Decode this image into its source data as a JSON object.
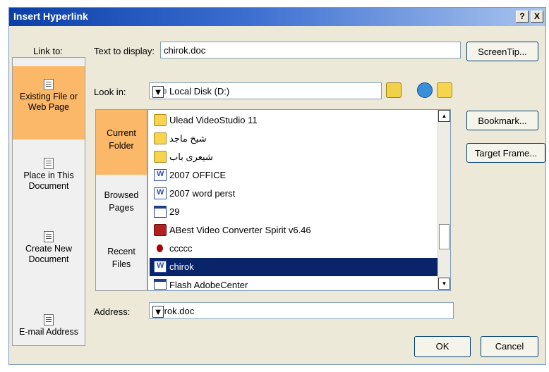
{
  "window": {
    "title": "Insert Hyperlink",
    "help_button": "?",
    "close_button": "X"
  },
  "link_to": {
    "label": "Link to:",
    "items": [
      {
        "line1": "Existing File or",
        "line2": "Web Page",
        "icon": "file-web-icon"
      },
      {
        "line1": "Place in This",
        "line2": "Document",
        "icon": "document-place-icon"
      },
      {
        "line1": "Create New",
        "line2": "Document",
        "icon": "new-document-icon"
      },
      {
        "line1": "E-mail Address",
        "line2": "",
        "icon": "email-icon"
      }
    ]
  },
  "text_to_display": {
    "label": "Text to display:",
    "value": "chirok.doc"
  },
  "buttons": {
    "screentip": "ScreenTip...",
    "bookmark": "Bookmark...",
    "target_frame": "Target Frame...",
    "ok": "OK",
    "cancel": "Cancel"
  },
  "look_in": {
    "label": "Look in:",
    "value": "Local Disk  (D:)"
  },
  "sub_nav": [
    {
      "line1": "Current",
      "line2": "Folder"
    },
    {
      "line1": "Browsed",
      "line2": "Pages"
    },
    {
      "line1": "Recent",
      "line2": "Files"
    }
  ],
  "files": [
    {
      "name": "Ulead VideoStudio 11",
      "icon": "folder-icon"
    },
    {
      "name": "شيخ ماجد",
      "icon": "folder-icon"
    },
    {
      "name": "شيعرى باب",
      "icon": "folder-icon"
    },
    {
      "name": "2007 OFFICE",
      "icon": "word-doc-icon"
    },
    {
      "name": "2007 word perst",
      "icon": "word-doc-icon"
    },
    {
      "name": "29",
      "icon": "app-window-icon"
    },
    {
      "name": "ABest Video Converter Spirit v6.46",
      "icon": "exe-icon"
    },
    {
      "name": "ccccc",
      "icon": "red-doc-icon"
    },
    {
      "name": "chirok",
      "icon": "word-doc-icon",
      "selected": true
    },
    {
      "name": "Flash AdobeCenter",
      "icon": "app-window-icon"
    }
  ],
  "address": {
    "label": "Address:",
    "value": "chirok.doc"
  }
}
